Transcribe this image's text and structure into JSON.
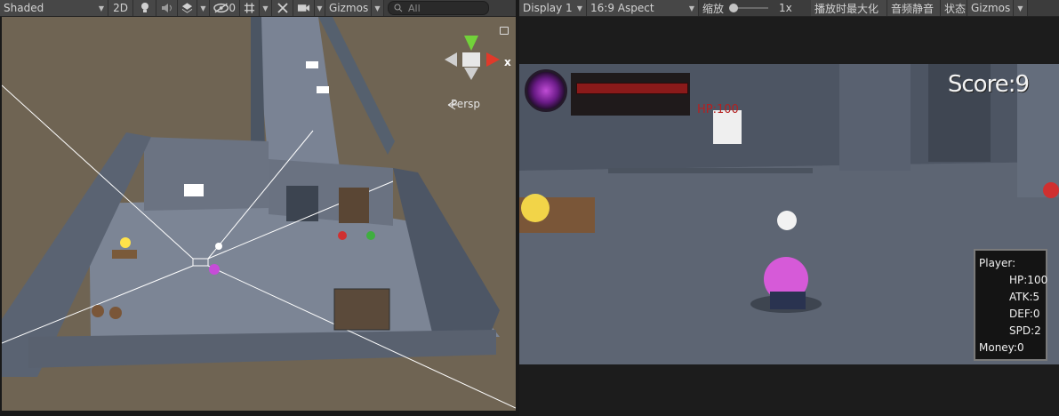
{
  "scene_toolbar": {
    "shading_mode": "Shaded",
    "mode_2d": "2D",
    "hidden_count": "0",
    "gizmos_label": "Gizmos",
    "search_placeholder": "All"
  },
  "scene_view": {
    "projection_label": "Persp",
    "axis_x_label": "x"
  },
  "game_toolbar": {
    "display": "Display 1",
    "aspect": "16:9 Aspect",
    "scale_label": "缩放",
    "scale_value": "1x",
    "maximize_on_play": "播放时最大化",
    "mute_audio": "音频静音",
    "stats": "状态",
    "gizmos_label": "Gizmos"
  },
  "game_view": {
    "score": "Score:9",
    "enemy_hp": "HP:100",
    "player_panel": {
      "title": "Player:",
      "hp": "HP:100",
      "atk": "ATK:5",
      "def": "DEF:0",
      "spd": "SPD:2",
      "money": "Money:0"
    }
  },
  "colors": {
    "toolbar_bg": "#3c3c3c",
    "editor_bg": "#191919",
    "floor": "#5d6573",
    "health_bar": "#8a1a1a",
    "score_text": "#f3f3f3",
    "hp_text": "#b52020"
  },
  "icons": [
    "light-icon",
    "audio-icon",
    "effects-icon",
    "visibility-icon",
    "grid-icon",
    "tools-icon",
    "camera-icon",
    "search-icon",
    "lock-icon",
    "scene-gizmo-icon",
    "chevron-down-icon"
  ]
}
